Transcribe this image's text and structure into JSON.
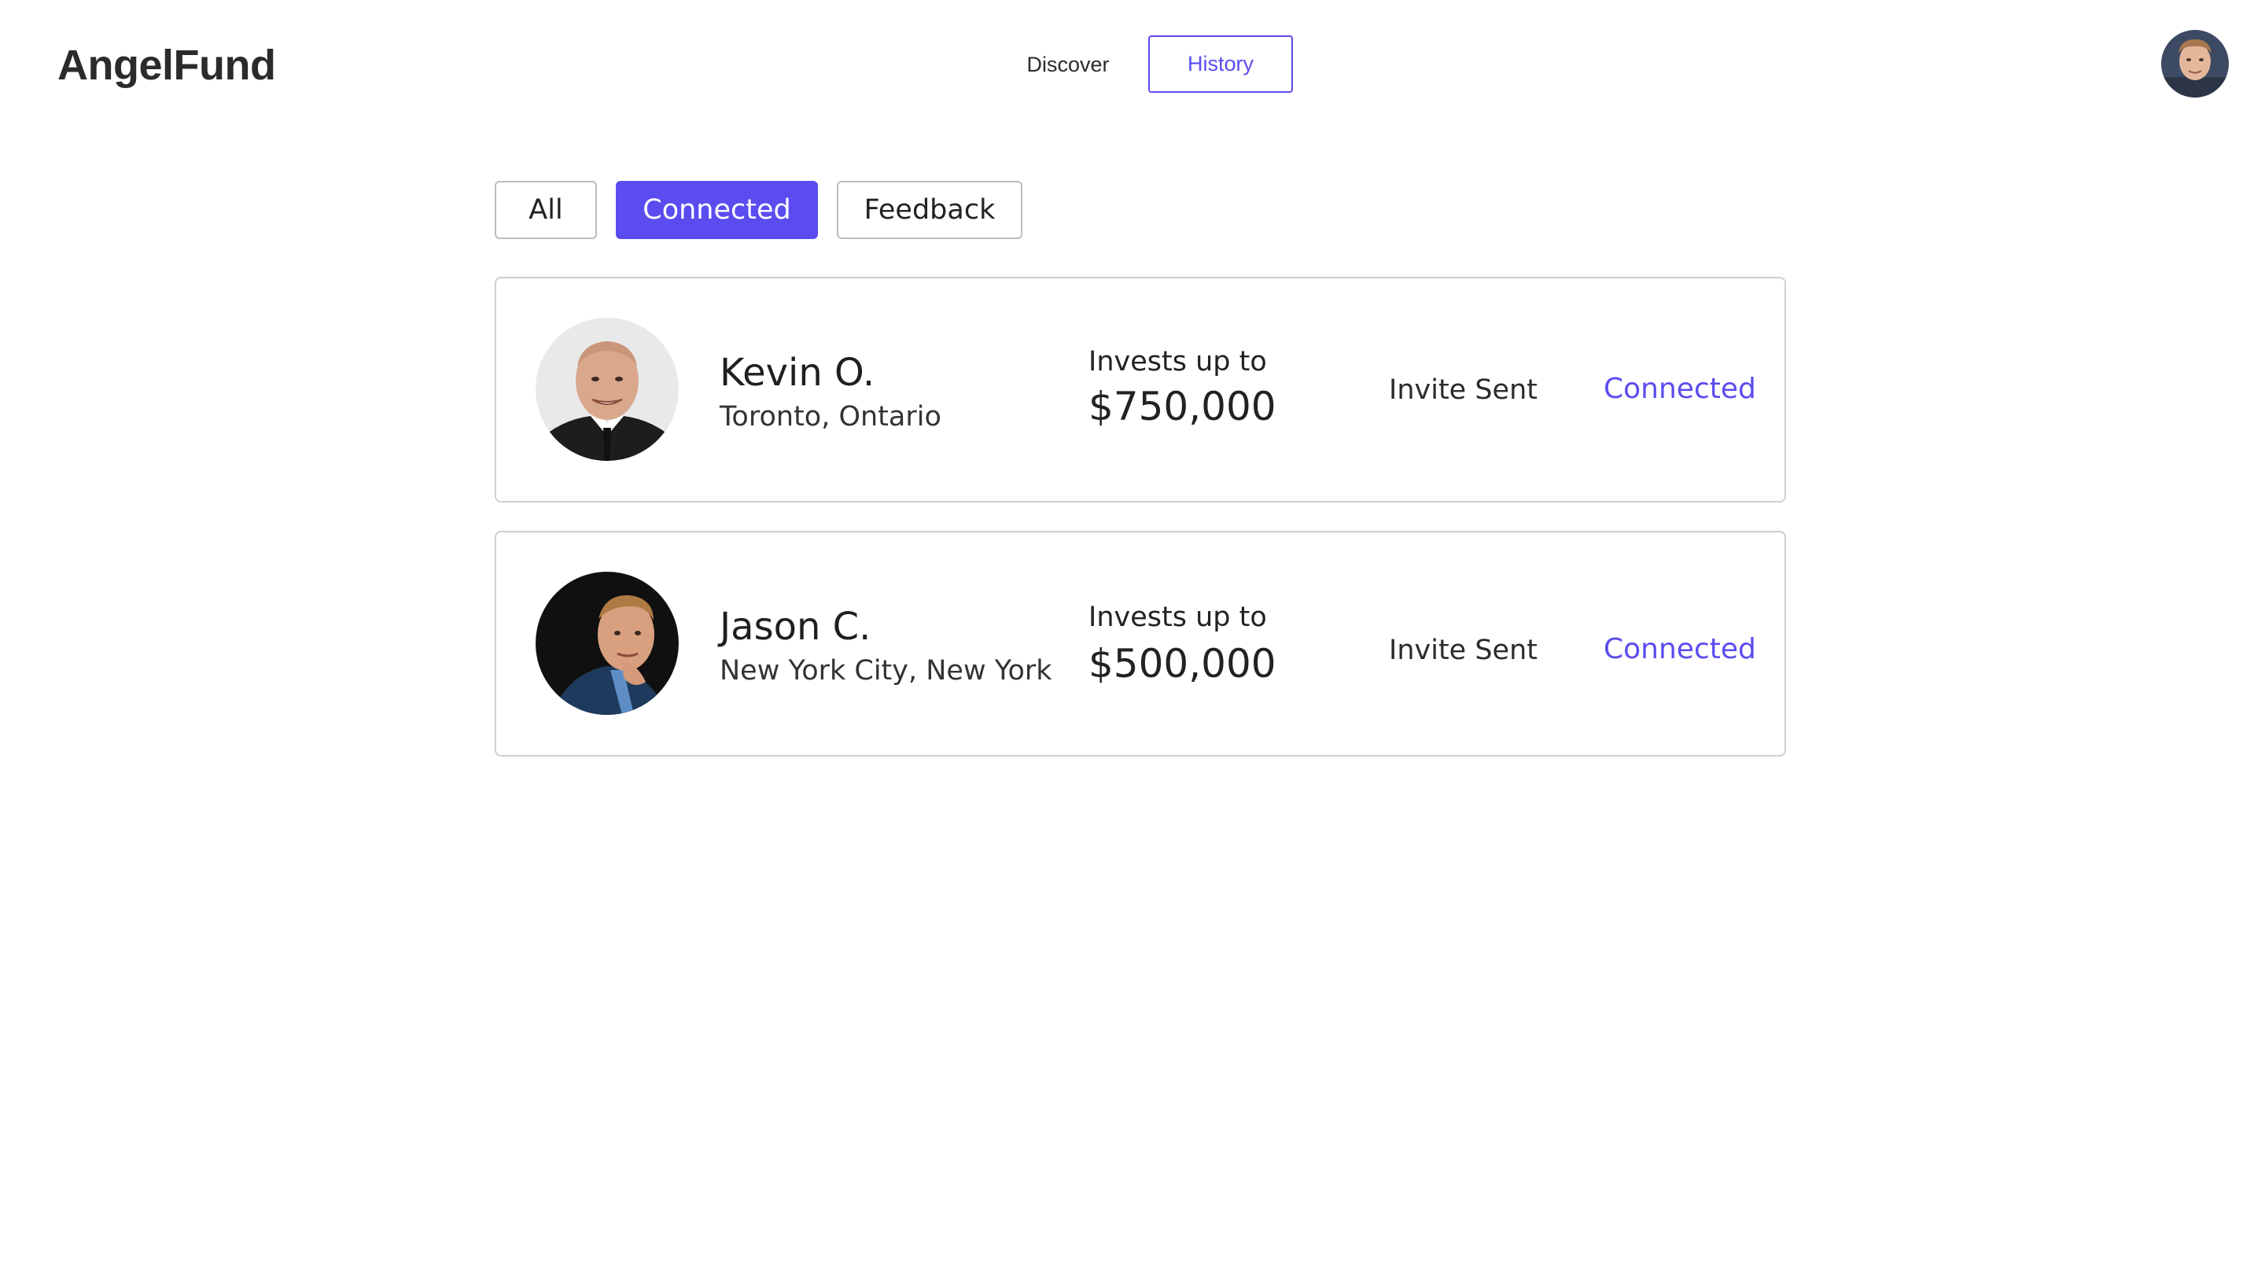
{
  "header": {
    "logo": "AngelFund",
    "nav": {
      "discover": "Discover",
      "history": "History"
    },
    "avatar_icon": "user-avatar"
  },
  "filters": {
    "all": "All",
    "connected": "Connected",
    "feedback": "Feedback",
    "active": "Connected"
  },
  "investors": [
    {
      "name": "Kevin O.",
      "location": "Toronto, Ontario",
      "invest_label": "Invests up to",
      "amount": "$750,000",
      "status": "Invite Sent",
      "connection": "Connected"
    },
    {
      "name": "Jason C.",
      "location": "New York City, New York",
      "invest_label": "Invests up to",
      "amount": "$500,000",
      "status": "Invite Sent",
      "connection": "Connected"
    }
  ],
  "colors": {
    "accent": "#5b4cf0",
    "text": "#222222",
    "border": "#cfcfcf"
  }
}
